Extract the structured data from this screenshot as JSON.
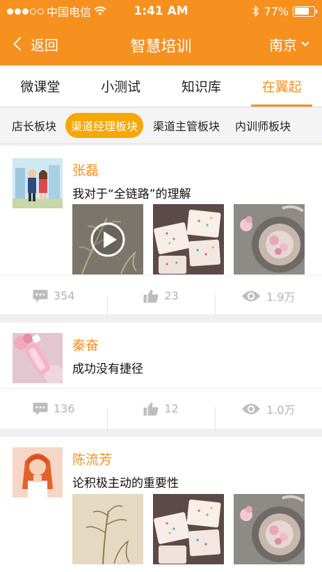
{
  "status": {
    "carrier": "中国电信",
    "time": "1:41 AM",
    "battery": "77%",
    "battery_level": 0.77
  },
  "nav": {
    "back_label": "返回",
    "title": "智慧培训",
    "city": "南京"
  },
  "tabs": [
    "微课堂",
    "小测试",
    "知识库",
    "在翼起"
  ],
  "subtabs": [
    "店长板块",
    "渠道经理板块",
    "渠道主管板块",
    "内训师板块"
  ],
  "posts": [
    {
      "author": "张磊",
      "title": "我对于“全链路”的理解",
      "comments": "354",
      "likes": "23",
      "views": "1.9万"
    },
    {
      "author": "秦奋",
      "title": "成功没有捷径",
      "comments": "136",
      "likes": "12",
      "views": "1.0万"
    },
    {
      "author": "陈流芳",
      "title": "论积极主动的重要性"
    }
  ],
  "colors": {
    "accent": "#f6901e",
    "subtab_active": "#f6a700"
  }
}
